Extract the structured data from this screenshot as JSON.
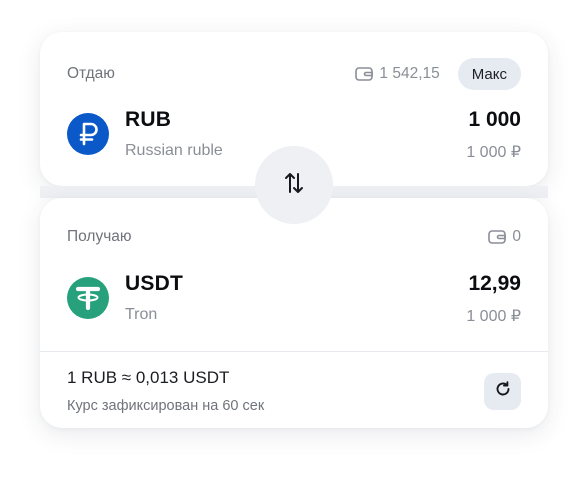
{
  "give": {
    "label": "Отдаю",
    "balance": "1 542,15",
    "max_label": "Макс",
    "asset_code": "RUB",
    "asset_name": "Russian ruble",
    "amount": "1 000",
    "fiat": "1 000 ₽",
    "icon": "ruble-icon",
    "coin_color": "#0b58c8"
  },
  "receive": {
    "label": "Получаю",
    "balance": "0",
    "asset_code": "USDT",
    "asset_name": "Tron",
    "amount": "12,99",
    "fiat": "1 000 ₽",
    "icon": "tether-icon",
    "coin_color": "#26a17b"
  },
  "rate": {
    "text": "1 RUB ≈ 0,013 USDT",
    "note": "Курс зафиксирован на 60 сек"
  },
  "icons": {
    "swap": "swap-arrows-icon",
    "refresh": "refresh-icon",
    "wallet": "wallet-icon"
  }
}
